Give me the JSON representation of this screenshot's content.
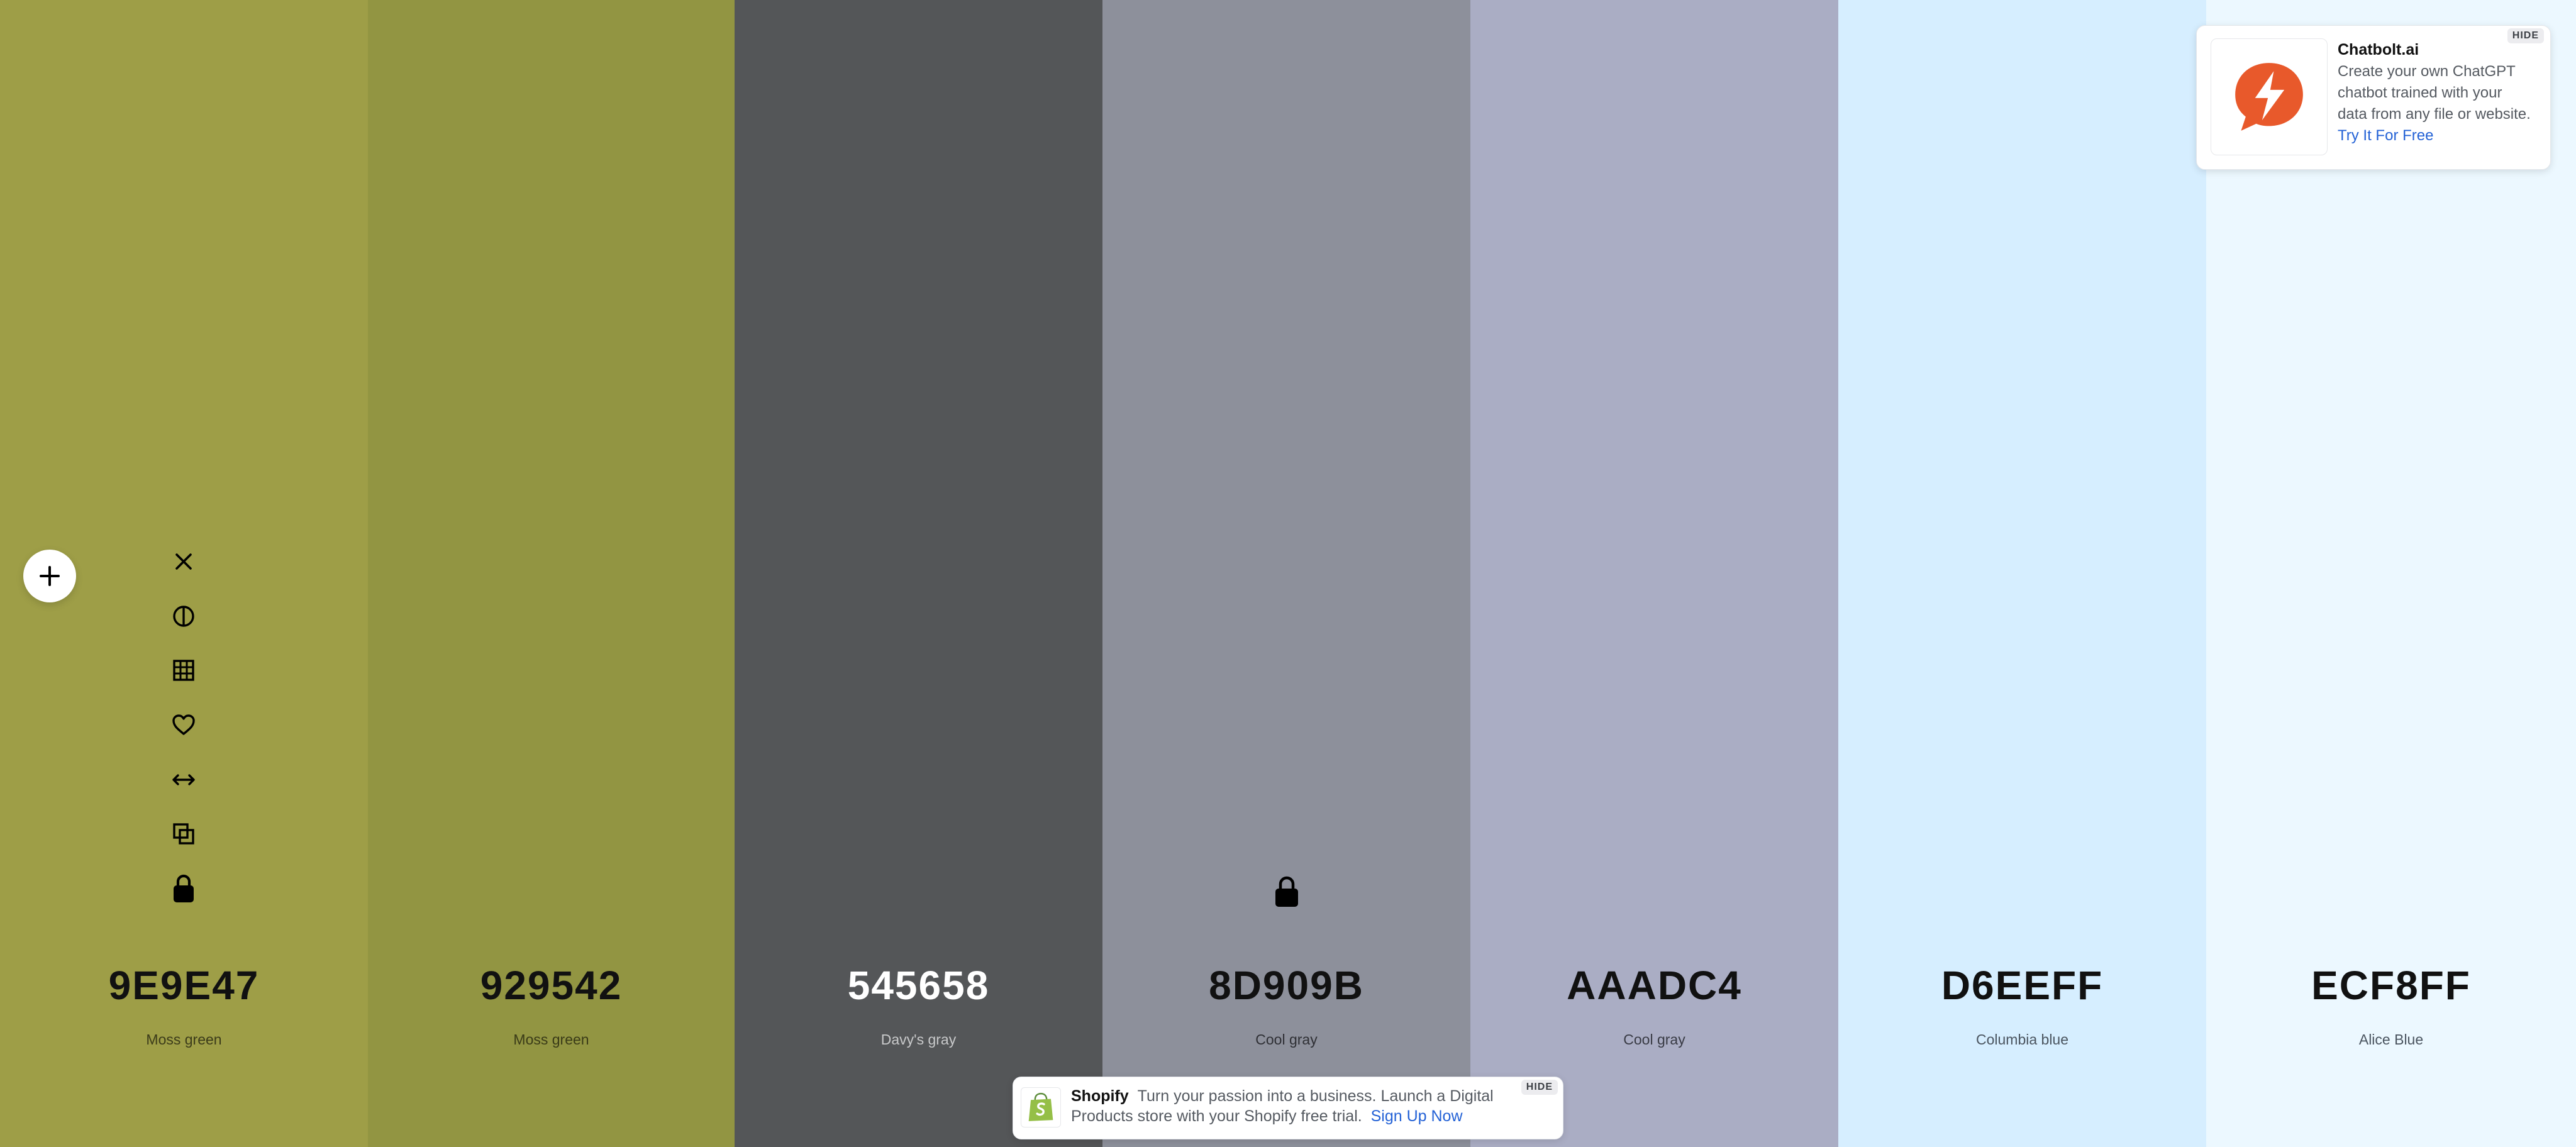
{
  "swatches": [
    {
      "hex": "9E9E47",
      "name": "Moss green",
      "bg": "#9E9E47",
      "text": "#111111",
      "sub": "#3b3b1a",
      "locked": false
    },
    {
      "hex": "929542",
      "name": "Moss green",
      "bg": "#929542",
      "text": "#111111",
      "sub": "#3a3b18",
      "locked": false
    },
    {
      "hex": "545658",
      "name": "Davy's gray",
      "bg": "#545658",
      "text": "#ffffff",
      "sub": "#c8c9ca",
      "locked": false
    },
    {
      "hex": "8D909B",
      "name": "Cool gray",
      "bg": "#8D909B",
      "text": "#111111",
      "sub": "#2f3035",
      "locked": true
    },
    {
      "hex": "AAADC4",
      "name": "Cool gray",
      "bg": "#AAADC4",
      "text": "#111111",
      "sub": "#393b45",
      "locked": false
    },
    {
      "hex": "D6EEFF",
      "name": "Columbia blue",
      "bg": "#D6EEFF",
      "text": "#111111",
      "sub": "#4b5560",
      "locked": false
    },
    {
      "hex": "ECF8FF",
      "name": "Alice Blue",
      "bg": "#ECF8FF",
      "text": "#111111",
      "sub": "#4b5560",
      "locked": false
    }
  ],
  "toolbar": {
    "icons": [
      "close-icon",
      "contrast-icon",
      "grid-icon",
      "heart-icon",
      "drag-horizontal-icon",
      "copy-icon",
      "lock-icon"
    ]
  },
  "ads": {
    "top": {
      "title": "Chatbolt.ai",
      "text": "Create your own ChatGPT chatbot trained with your data from any file or website.",
      "link": "Try It For Free",
      "hide": "HIDE",
      "brand_color": "#E8592B"
    },
    "bottom": {
      "title": "Shopify",
      "text": "Turn your passion into a business. Launch a Digital Products store with your Shopify free trial.",
      "link": "Sign Up Now",
      "hide": "HIDE",
      "brand_color": "#95BF47"
    }
  }
}
